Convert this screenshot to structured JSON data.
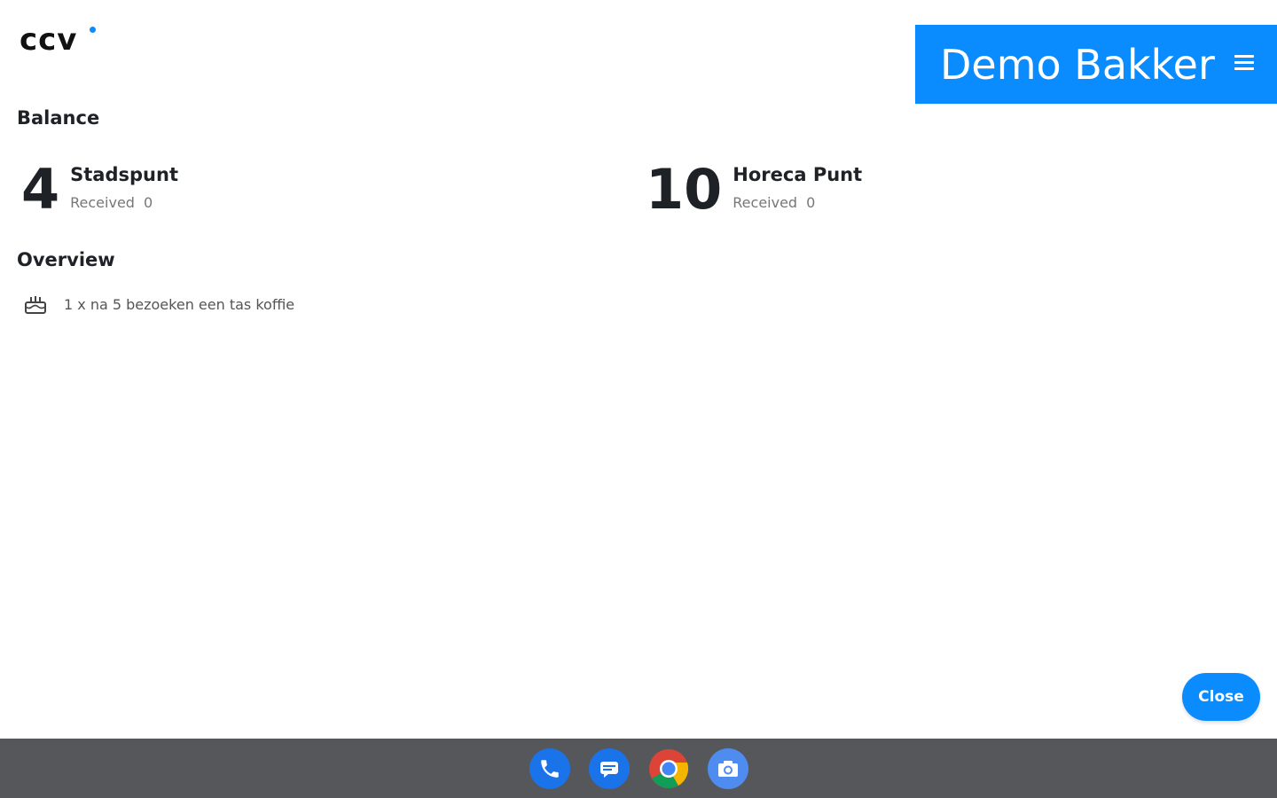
{
  "header": {
    "logo_text": "ccv",
    "merchant_name": "Demo Bakker",
    "accent_color": "#0a8cff"
  },
  "balance": {
    "title": "Balance",
    "cards": [
      {
        "count": "4",
        "name": "Stadspunt",
        "received_label": "Received",
        "received_value": "0"
      },
      {
        "count": "10",
        "name": "Horeca Punt",
        "received_label": "Received",
        "received_value": "0"
      }
    ]
  },
  "overview": {
    "title": "Overview",
    "items": [
      {
        "icon": "cake-icon",
        "text": "1 x na 5 bezoeken een tas koffie"
      }
    ]
  },
  "actions": {
    "close_label": "Close"
  },
  "taskbar": {
    "background": "#55575b",
    "apps": [
      "phone-icon",
      "messages-icon",
      "chrome-icon",
      "camera-icon"
    ]
  }
}
